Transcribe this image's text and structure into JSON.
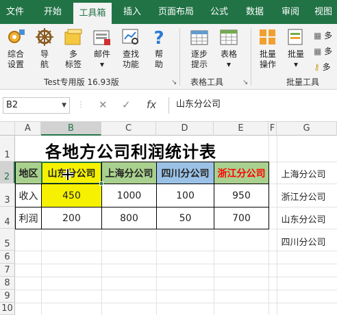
{
  "ribbon_tabs": [
    "文件",
    "开始",
    "工具箱",
    "插入",
    "页面布局",
    "公式",
    "数据",
    "审阅",
    "视图"
  ],
  "ribbon": {
    "buttons": [
      {
        "line1": "综合",
        "line2": "设置"
      },
      {
        "line1": "导",
        "line2": "航"
      },
      {
        "line1": "多",
        "line2": "标签"
      },
      {
        "line1": "邮件",
        "line2": "▾"
      },
      {
        "line1": "查找",
        "line2": "功能"
      },
      {
        "line1": "帮",
        "line2": "助"
      },
      {
        "line1": "逐步",
        "line2": "提示"
      },
      {
        "line1": "表格",
        "line2": "▾"
      },
      {
        "line1": "批量",
        "line2": "操作"
      },
      {
        "line1": "批量",
        "line2": "▾"
      }
    ],
    "mini_items": [
      "多",
      "多",
      "多"
    ],
    "group_labels": [
      "Test专用版 16.93版",
      "表格工具",
      "批量工具"
    ]
  },
  "formula_bar": {
    "name_box": "B2",
    "cancel": "✕",
    "enter": "✓",
    "fx": "fx",
    "content": "山东分公司"
  },
  "columns": [
    "A",
    "B",
    "C",
    "D",
    "E",
    "F",
    "G"
  ],
  "rows": [
    "1",
    "2",
    "3",
    "4",
    "5",
    "6",
    "7",
    "8",
    "9",
    "10"
  ],
  "sheet": {
    "title": "各地方公司利润统计表",
    "header": [
      "地区",
      "山东分公司",
      "上海分公司",
      "四川分公司",
      "浙江分公司"
    ],
    "income": [
      "收入",
      "450",
      "1000",
      "100",
      "950"
    ],
    "profit": [
      "利润",
      "200",
      "800",
      "50",
      "700"
    ],
    "side_list": [
      "上海分公司",
      "浙江分公司",
      "山东分公司",
      "四川分公司"
    ]
  },
  "colors": {
    "excel_green": "#217346",
    "header_green": "#a9d08e",
    "header_blue": "#9bc2e6",
    "highlight_yellow": "#f5f100",
    "zhejiang_red": "#ff0000"
  }
}
